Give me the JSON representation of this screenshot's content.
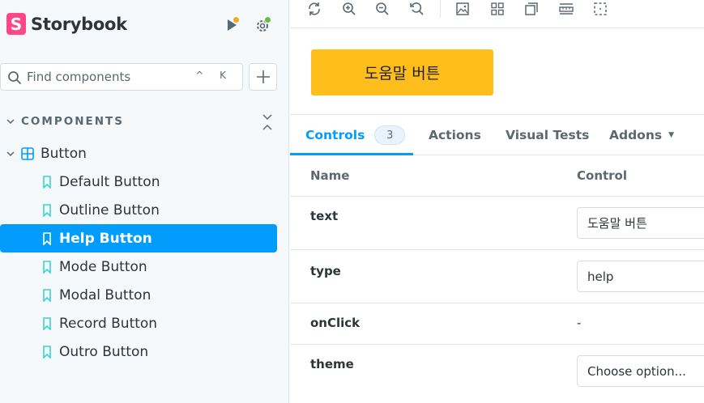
{
  "brand": {
    "logo_letter": "S",
    "name": "Storybook"
  },
  "search": {
    "placeholder": "Find components",
    "shortcut": "^ K"
  },
  "sidebar": {
    "section_label": "COMPONENTS",
    "group": {
      "label": "Button",
      "expanded": true
    },
    "stories": [
      {
        "label": "Default Button",
        "selected": false
      },
      {
        "label": "Outline Button",
        "selected": false
      },
      {
        "label": "Help Button",
        "selected": true
      },
      {
        "label": "Mode Button",
        "selected": false
      },
      {
        "label": "Modal Button",
        "selected": false
      },
      {
        "label": "Record Button",
        "selected": false
      },
      {
        "label": "Outro Button",
        "selected": false
      }
    ]
  },
  "toolbar": {
    "icons": [
      "sync-icon",
      "zoom-in-icon",
      "zoom-out-icon",
      "zoom-reset-icon",
      "image-icon",
      "grid-icon",
      "photo-drag-icon",
      "ruler-icon",
      "outline-icon"
    ]
  },
  "preview": {
    "button_label": "도움말 버튼",
    "button_color": "#ffbe1b"
  },
  "tabs": {
    "controls": "Controls",
    "controls_count": "3",
    "actions": "Actions",
    "visual_tests": "Visual Tests",
    "addons": "Addons"
  },
  "table": {
    "headers": {
      "name": "Name",
      "control": "Control"
    },
    "rows": [
      {
        "name": "text",
        "value": "도움말 버튼"
      },
      {
        "name": "type",
        "value": "help"
      },
      {
        "name": "onClick",
        "value": "-"
      },
      {
        "name": "theme",
        "value": "Choose option..."
      }
    ]
  },
  "colors": {
    "accent": "#029cfd",
    "brand": "#ff4785",
    "status_orange": "#f5a623",
    "status_green": "#66bf3c"
  }
}
